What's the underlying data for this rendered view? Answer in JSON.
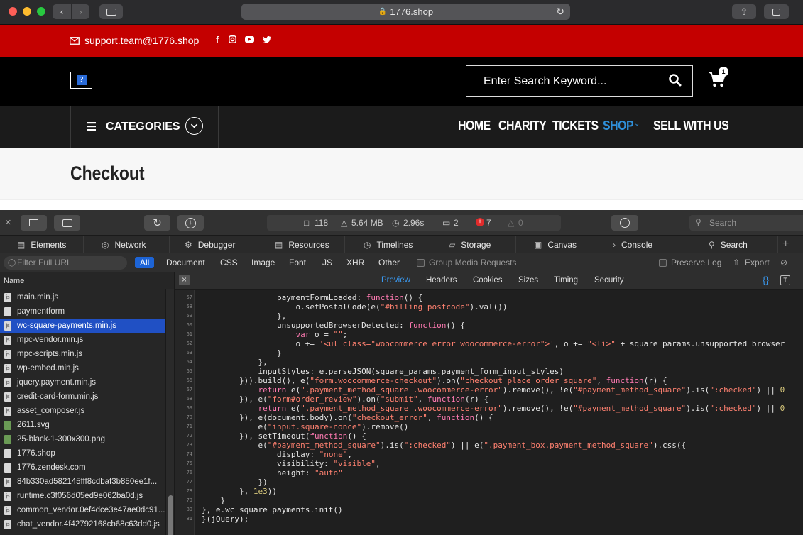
{
  "browser": {
    "url": "1776.shop"
  },
  "site": {
    "support_email": "support.team@1776.shop",
    "social_icons": [
      "facebook-icon",
      "instagram-icon",
      "youtube-icon",
      "twitter-icon"
    ],
    "search_placeholder": "Enter Search Keyword...",
    "cart_count": "1",
    "categories_label": "CATEGORIES",
    "nav": {
      "home": "HOME",
      "charity": "CHARITY",
      "tickets": "TICKETS",
      "shop": "SHOP",
      "sell": "SELL WITH US"
    },
    "page_title": "Checkout",
    "colors": {
      "topbar": "#c40000",
      "header": "#000000",
      "nav_active": "#2f8fd8"
    }
  },
  "inspector": {
    "stats": {
      "resources": "118",
      "size": "5.64 MB",
      "time": "2.96s",
      "messages": "2",
      "errors": "7",
      "warnings": "0"
    },
    "search_placeholder": "Search",
    "tabs": [
      "Elements",
      "Network",
      "Debugger",
      "Resources",
      "Timelines",
      "Storage",
      "Canvas",
      "Console",
      "Search"
    ],
    "filter": {
      "placeholder": "Filter Full URL",
      "types": [
        "All",
        "Document",
        "CSS",
        "Image",
        "Font",
        "JS",
        "XHR",
        "Other"
      ],
      "group_media": "Group Media Requests",
      "preserve_log": "Preserve Log",
      "export": "Export"
    },
    "sidebar_header": "Name",
    "files": [
      "main.min.js",
      "paymentform",
      "wc-square-payments.min.js",
      "mpc-vendor.min.js",
      "mpc-scripts.min.js",
      "wp-embed.min.js",
      "jquery.payment.min.js",
      "credit-card-form.min.js",
      "asset_composer.js",
      "2611.svg",
      "25-black-1-300x300.png",
      "1776.shop",
      "1776.zendesk.com",
      "84b330ad582145fff8cdbaf3b850ee1f...",
      "runtime.c3f056d05ed9e062ba0d.js",
      "common_vendor.0ef4dce3e47ae0dc91...",
      "chat_vendor.4f42792168cb68c63dd0.js"
    ],
    "selected_file": 2,
    "preview_tabs": [
      "Preview",
      "Headers",
      "Cookies",
      "Sizes",
      "Timing",
      "Security"
    ],
    "code_lines": [
      {
        "n": "57",
        "html": "                paymentFormLoaded: <span class=\"kw\">function</span>() {"
      },
      {
        "n": "58",
        "html": "                    o.setPostalCode(e(<span class=\"st\">\"#billing_postcode\"</span>).val())"
      },
      {
        "n": "59",
        "html": "                },"
      },
      {
        "n": "60",
        "html": "                unsupportedBrowserDetected: <span class=\"kw\">function</span>() {"
      },
      {
        "n": "61",
        "html": "                    <span class=\"kw\">var</span> o = <span class=\"st\">\"\"</span>;"
      },
      {
        "n": "62",
        "html": "                    o += <span class=\"st\">'&lt;ul class=\"woocommerce_error woocommerce-error\"&gt;'</span>, o += <span class=\"st\">\"&lt;li&gt;\"</span> + square_params.unsupported_browser"
      },
      {
        "n": "63",
        "html": "                }"
      },
      {
        "n": "64",
        "html": "            },"
      },
      {
        "n": "65",
        "html": "            inputStyles: e.parseJSON(square_params.payment_form_input_styles)"
      },
      {
        "n": "66",
        "html": "        })).build(), e(<span class=\"st\">\"form.woocommerce-checkout\"</span>).on(<span class=\"st\">\"checkout_place_order_square\"</span>, <span class=\"kw\">function</span>(r) {"
      },
      {
        "n": "67",
        "html": "            <span class=\"kw\">return</span> e(<span class=\"st\">\".payment_method_square .woocommerce-error\"</span>).remove(), !e(<span class=\"st\">\"#payment_method_square\"</span>).is(<span class=\"st\">\":checked\"</span>) || <span class=\"nu\">0</span>"
      },
      {
        "n": "68",
        "html": "        }), e(<span class=\"st\">\"form#order_review\"</span>).on(<span class=\"st\">\"submit\"</span>, <span class=\"kw\">function</span>(r) {"
      },
      {
        "n": "69",
        "html": "            <span class=\"kw\">return</span> e(<span class=\"st\">\".payment_method_square .woocommerce-error\"</span>).remove(), !e(<span class=\"st\">\"#payment_method_square\"</span>).is(<span class=\"st\">\":checked\"</span>) || <span class=\"nu\">0</span>"
      },
      {
        "n": "70",
        "html": "        }), e(document.body).on(<span class=\"st\">\"checkout_error\"</span>, <span class=\"kw\">function</span>() {"
      },
      {
        "n": "71",
        "html": "            e(<span class=\"st\">\"input.square-nonce\"</span>).remove()"
      },
      {
        "n": "72",
        "html": "        }), setTimeout(<span class=\"kw\">function</span>() {"
      },
      {
        "n": "73",
        "html": "            e(<span class=\"st\">\"#payment_method_square\"</span>).is(<span class=\"st\">\":checked\"</span>) || e(<span class=\"st\">\".payment_box.payment_method_square\"</span>).css({"
      },
      {
        "n": "74",
        "html": "                display: <span class=\"st\">\"none\"</span>,"
      },
      {
        "n": "75",
        "html": "                visibility: <span class=\"st\">\"visible\"</span>,"
      },
      {
        "n": "76",
        "html": "                height: <span class=\"st\">\"auto\"</span>"
      },
      {
        "n": "77",
        "html": "            })"
      },
      {
        "n": "78",
        "html": "        }, <span class=\"nu\">1e3</span>))"
      },
      {
        "n": "79",
        "html": "    }"
      },
      {
        "n": "80",
        "html": "}, e.wc_square_payments.init()"
      },
      {
        "n": "81",
        "html": "}(jQuery);"
      }
    ]
  }
}
